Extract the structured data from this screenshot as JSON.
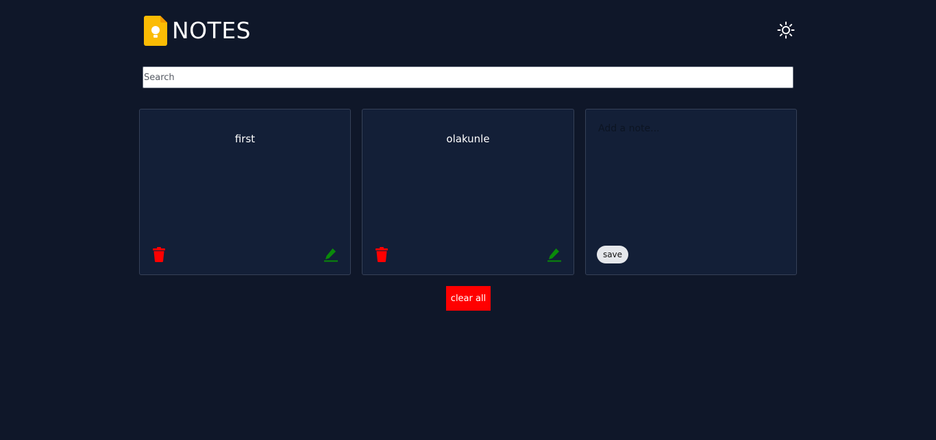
{
  "header": {
    "title": "NOTES",
    "logo_icon": "keep-notes-logo",
    "theme_icon": "sun-icon"
  },
  "search": {
    "placeholder": "Search",
    "value": ""
  },
  "notes": [
    {
      "title": "first",
      "delete_icon": "trash-icon",
      "edit_icon": "pencil-icon"
    },
    {
      "title": "olakunle",
      "delete_icon": "trash-icon",
      "edit_icon": "pencil-icon"
    }
  ],
  "new_note": {
    "placeholder": "Add a note...",
    "value": "",
    "save_label": "save"
  },
  "actions": {
    "clear_all_label": "clear all"
  },
  "colors": {
    "background": "#0f1729",
    "card": "#131f37",
    "card_border": "#364158",
    "delete": "#ff0000",
    "edit": "#0a8a0a",
    "clear_button": "#ff0000",
    "logo": "#fbbc04"
  }
}
